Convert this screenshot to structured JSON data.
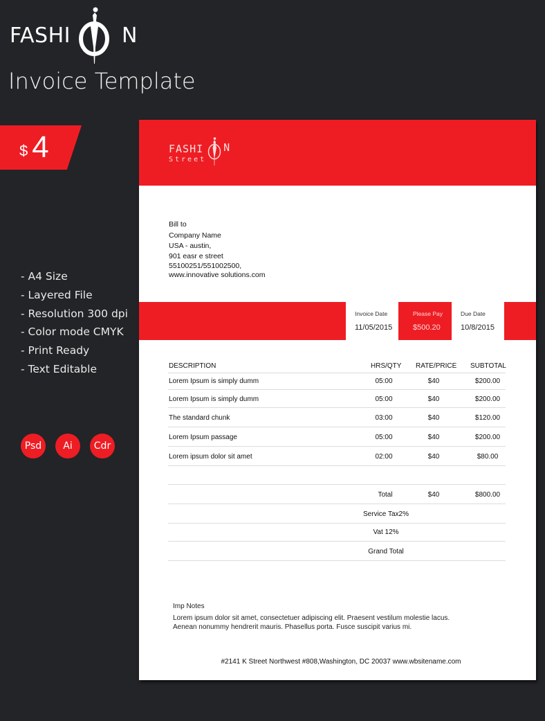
{
  "brand": {
    "name_left": "FASHI",
    "name_right": "N",
    "logo_icon": "fashion-figure-ring-logo"
  },
  "subtitle": "Invoice Template",
  "price": {
    "currency": "$",
    "amount": "4"
  },
  "features": [
    "- A4 Size",
    "- Layered File",
    "- Resolution 300 dpi",
    "- Color mode CMYK",
    "- Print Ready",
    "- Text Editable"
  ],
  "formats": [
    "Psd",
    "Ai",
    "Cdr"
  ],
  "colors": {
    "accent": "#ee1d24",
    "background": "#232427",
    "paper": "#ffffff"
  },
  "invoice": {
    "logo": {
      "word_left": "FASHI",
      "word_right": "N",
      "tagline": "Street"
    },
    "bill_to": {
      "label": "Bill to",
      "company": "Company Name",
      "location": "USA - austin,",
      "street": "901 easr e street",
      "phone": "55100251/551002500,",
      "website": "www.innovative solutions.com"
    },
    "summary": {
      "invoice_date_label": "Invoice Date",
      "invoice_date": "11/05/2015",
      "please_pay_label": "Please Pay",
      "please_pay": "$500.20",
      "due_date_label": "Due Date",
      "due_date": "10/8/2015"
    },
    "table": {
      "headers": [
        "DESCRIPTION",
        "HRS/QTY",
        "RATE/PRICE",
        "SUBTOTAL"
      ],
      "rows": [
        {
          "description": "Lorem Ipsum is simply dumm",
          "qty": "05:00",
          "rate": "$40",
          "subtotal": "$200.00"
        },
        {
          "description": "Lorem Ipsum is simply dumm",
          "qty": "05:00",
          "rate": "$40",
          "subtotal": "$200.00"
        },
        {
          "description": "The standard chunk",
          "qty": "03:00",
          "rate": "$40",
          "subtotal": "$120.00"
        },
        {
          "description": "Lorem Ipsum passage",
          "qty": "05:00",
          "rate": "$40",
          "subtotal": "$200.00"
        },
        {
          "description": "Lorem ipsum dolor sit amet",
          "qty": "02:00",
          "rate": "$40",
          "subtotal": "$80.00"
        }
      ],
      "totals": {
        "total_label": "Total",
        "total_rate": "$40",
        "total_amount": "$800.00",
        "service_tax_label": "Service Tax2%",
        "vat_label": "Vat 12%",
        "grand_total_label": "Grand Total"
      }
    },
    "notes": {
      "title": "Imp Notes",
      "line1": "Lorem ipsum dolor sit amet, consectetuer adipiscing elit. Praesent vestilum molestie lacus.",
      "line2": "Aenean nonummy hendrerit mauris. Phasellus porta. Fusce suscipit varius mi."
    },
    "footer": "#2141 K Street Northwest #808,Washington, DC 20037 www.wbsitename.com"
  }
}
